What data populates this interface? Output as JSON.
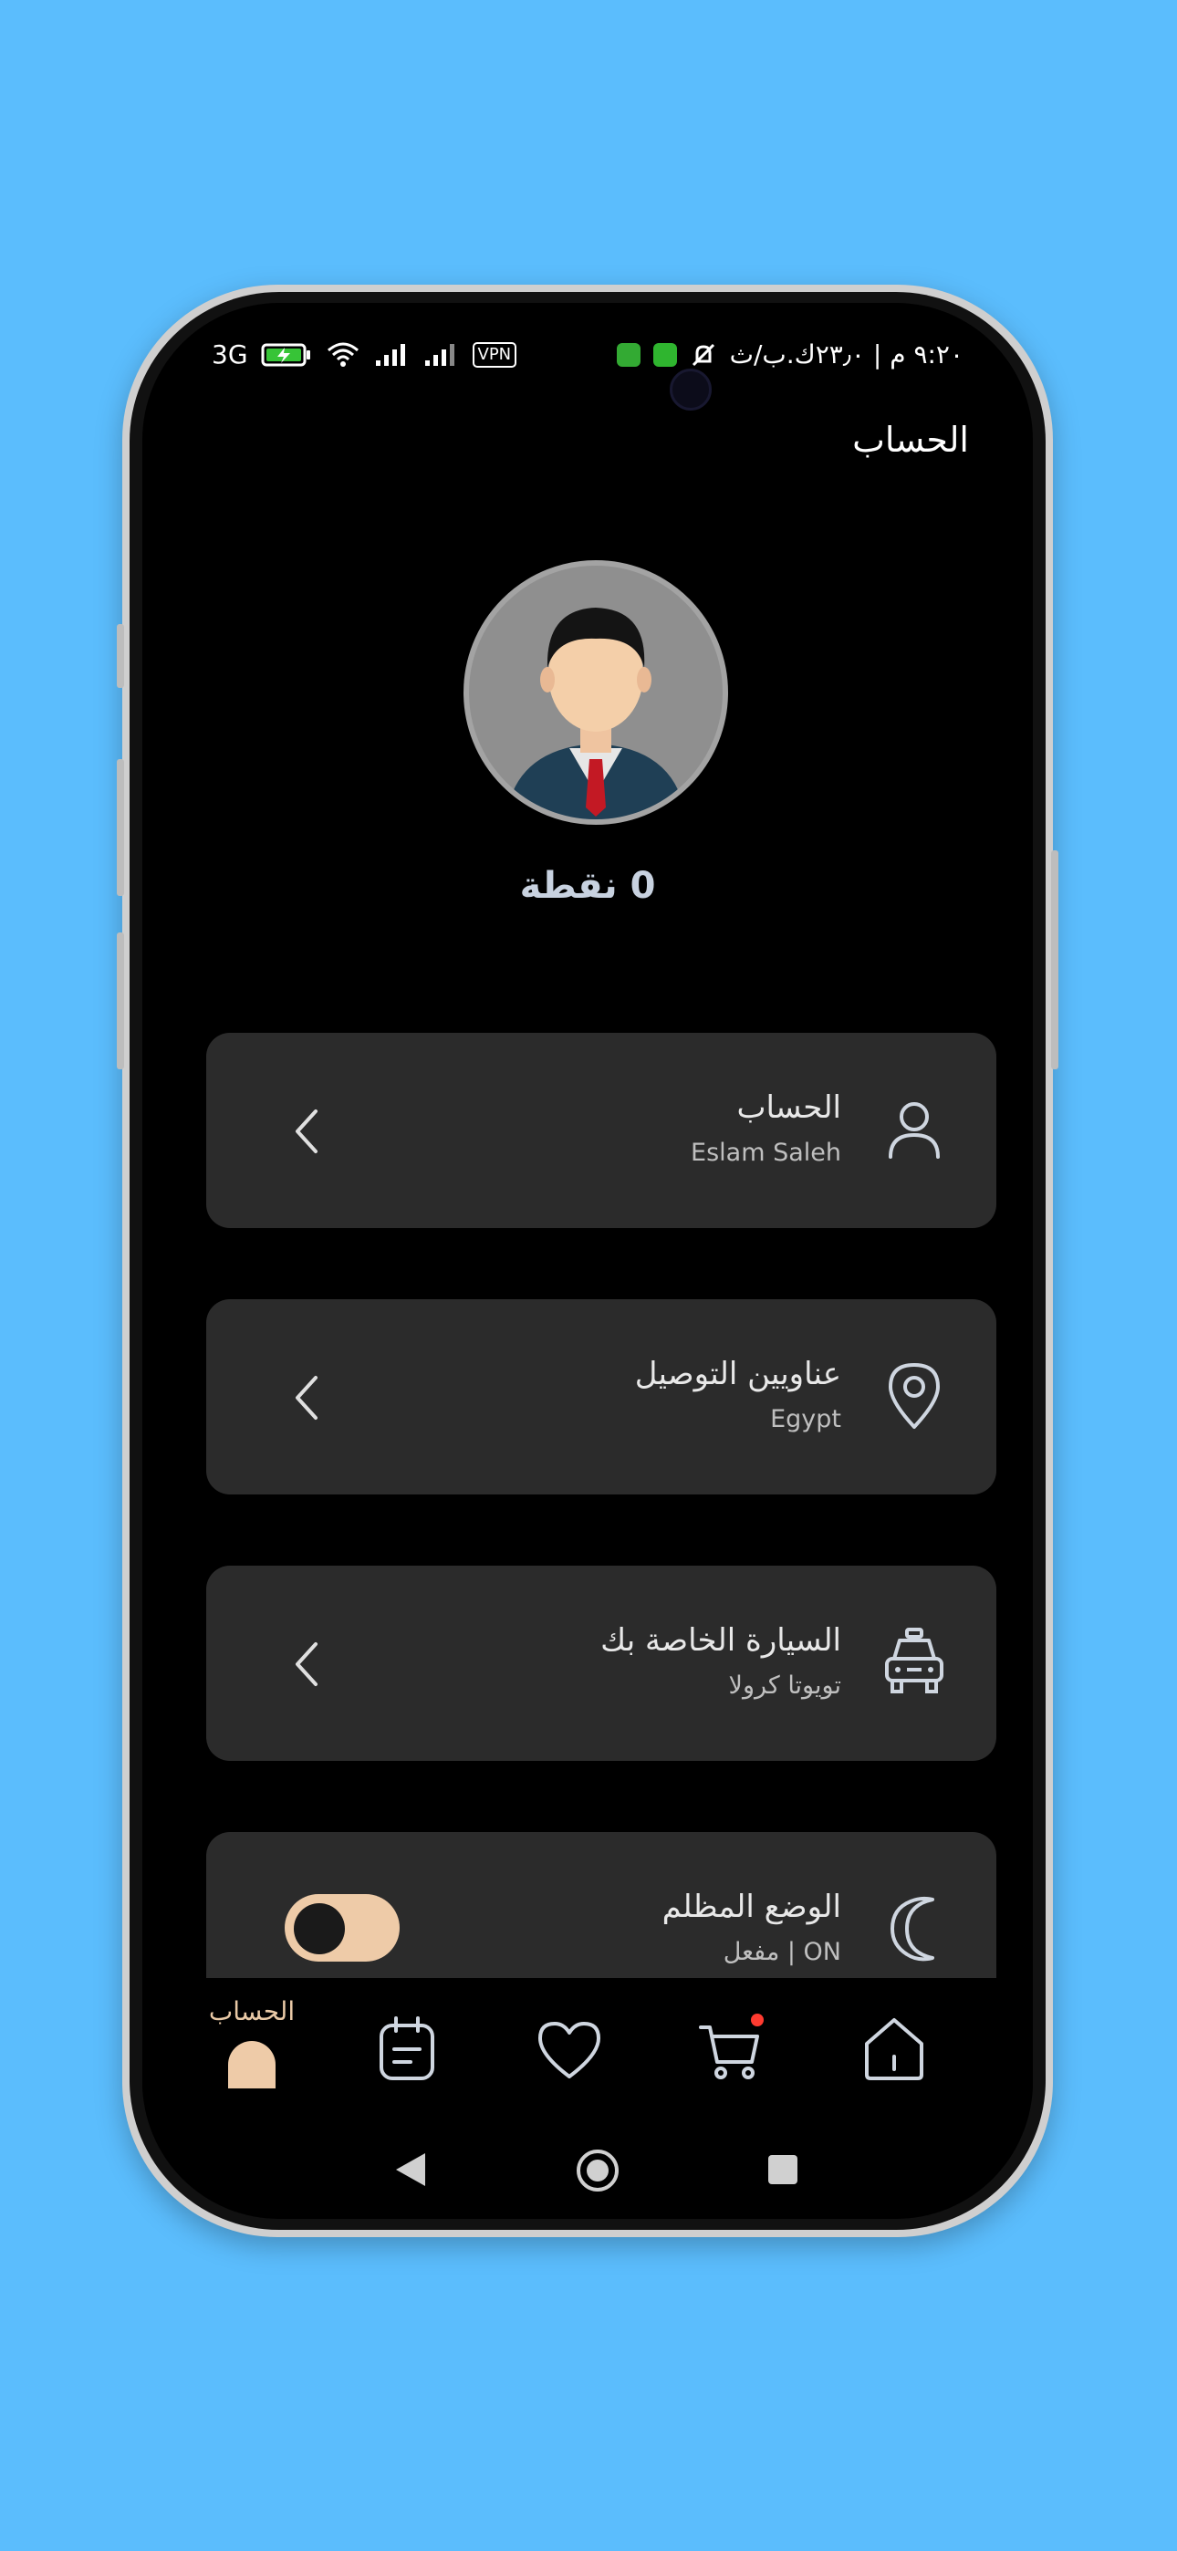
{
  "status_bar": {
    "left_text": "3G",
    "right_text": "٩:٢٠ م | ٢٣٫٠ك.ب/ث",
    "vpn_label": "VPN"
  },
  "header": {
    "title": "الحساب"
  },
  "profile": {
    "points_label": "0  نقطة"
  },
  "cards": [
    {
      "title": "الحساب",
      "subtitle": "Eslam Saleh",
      "icon": "user-icon"
    },
    {
      "title": "عناويين التوصيل",
      "subtitle": "Egypt",
      "icon": "location-pin-icon"
    },
    {
      "title": "السيارة الخاصة بك",
      "subtitle": "تويوتا كرولا",
      "icon": "taxi-car-icon"
    },
    {
      "title": "الوضع المظلم",
      "subtitle": "ON | مفعل",
      "icon": "moon-icon"
    }
  ],
  "dark_mode": {
    "enabled": true
  },
  "bottom_nav": {
    "active_label": "الحساب",
    "items": [
      "account",
      "orders",
      "favorites",
      "cart",
      "home"
    ],
    "cart_badge_color": "#ff3b30"
  },
  "colors": {
    "background": "#5bbdfd",
    "accent": "#eecba8",
    "card": "#2b2b2b"
  }
}
